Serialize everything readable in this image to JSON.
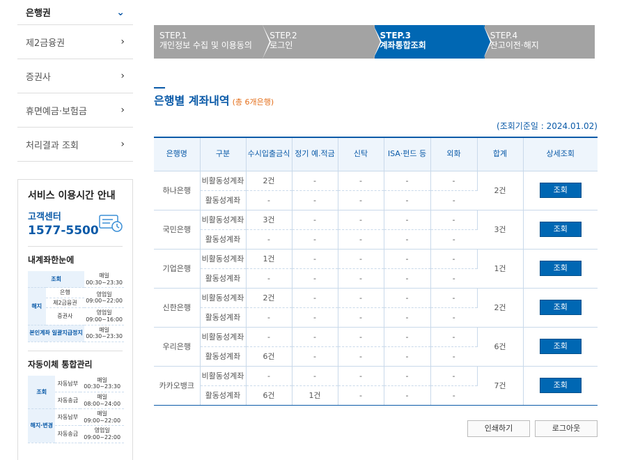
{
  "sidebar": {
    "items": [
      {
        "label": "은행권"
      },
      {
        "label": "제2금융권"
      },
      {
        "label": "증권사"
      },
      {
        "label": "휴면예금·보험금"
      },
      {
        "label": "처리결과 조회"
      }
    ]
  },
  "info": {
    "title": "서비스 이용시간 안내",
    "cc_label": "고객센터",
    "cc_phone": "1577-5500",
    "section1": {
      "title": "내계좌한눈에",
      "rows": [
        {
          "cat": "조회",
          "sub": "",
          "time1": "매일",
          "time2": "00:30~23:30"
        },
        {
          "cat": "해지",
          "sub": "은행",
          "time1": "영업일",
          "time2": "09:00~22:00"
        },
        {
          "cat": "",
          "sub": "제2금융권",
          "time1": "",
          "time2": ""
        },
        {
          "cat": "",
          "sub": "증권사",
          "time1": "영업일",
          "time2": "09:00~16:00"
        },
        {
          "cat": "본인계좌 일괄지급정지",
          "sub": "",
          "time1": "매일",
          "time2": "00:30~23:30"
        }
      ]
    },
    "section2": {
      "title": "자동이체 통합관리",
      "rows": [
        {
          "cat": "조회",
          "sub": "자동납부",
          "time1": "매일",
          "time2": "00:30~23:30"
        },
        {
          "cat": "",
          "sub": "자동송금",
          "time1": "매일",
          "time2": "08:00~24:00"
        },
        {
          "cat": "해지·변경",
          "sub": "자동납부",
          "time1": "매일",
          "time2": "09:00~22:00"
        },
        {
          "cat": "",
          "sub": "자동송금",
          "time1": "영업일",
          "time2": "09:00~22:00"
        }
      ]
    }
  },
  "steps": [
    {
      "num": "STEP.1",
      "label": "개인정보 수집 및 이용동의"
    },
    {
      "num": "STEP.2",
      "label": "로그인"
    },
    {
      "num": "STEP.3",
      "label": "계좌통합조회"
    },
    {
      "num": "STEP.4",
      "label": "잔고이전·해지"
    }
  ],
  "section": {
    "title": "은행별 계좌내역",
    "count": "(총 6개은행)",
    "ref_date": "(조회기준일 : 2024.01.02)"
  },
  "table": {
    "headers": [
      "은행명",
      "구분",
      "수시입출금식",
      "정기 예.적금",
      "신탁",
      "ISA·펀드 등",
      "외화",
      "합계",
      "상세조회"
    ],
    "rows": [
      {
        "bank": "하나은행",
        "inactive": [
          "2건",
          "-",
          "-",
          "-",
          "-"
        ],
        "active": [
          "-",
          "-",
          "-",
          "-",
          "-"
        ],
        "total": "2건"
      },
      {
        "bank": "국민은행",
        "inactive": [
          "3건",
          "-",
          "-",
          "-",
          "-"
        ],
        "active": [
          "-",
          "-",
          "-",
          "-",
          "-"
        ],
        "total": "3건"
      },
      {
        "bank": "기업은행",
        "inactive": [
          "1건",
          "-",
          "-",
          "-",
          "-"
        ],
        "active": [
          "-",
          "-",
          "-",
          "-",
          "-"
        ],
        "total": "1건"
      },
      {
        "bank": "신한은행",
        "inactive": [
          "2건",
          "-",
          "-",
          "-",
          "-"
        ],
        "active": [
          "-",
          "-",
          "-",
          "-",
          "-"
        ],
        "total": "2건"
      },
      {
        "bank": "우리은행",
        "inactive": [
          "-",
          "-",
          "-",
          "-",
          "-"
        ],
        "active": [
          "6건",
          "-",
          "-",
          "-",
          "-"
        ],
        "total": "6건"
      },
      {
        "bank": "카카오뱅크",
        "inactive": [
          "-",
          "-",
          "-",
          "-",
          "-"
        ],
        "active": [
          "6건",
          "1건",
          "-",
          "-",
          "-"
        ],
        "total": "7건"
      }
    ],
    "inactive_label": "비활동성계좌",
    "active_label": "활동성계좌",
    "detail_label": "조회"
  },
  "buttons": {
    "print": "인쇄하기",
    "logout": "로그아웃"
  }
}
